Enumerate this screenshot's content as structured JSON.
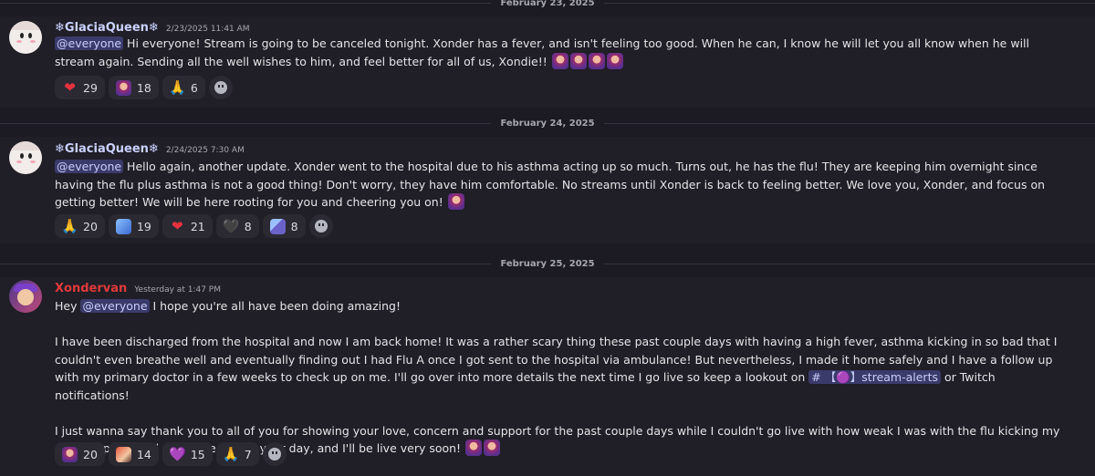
{
  "dividers": {
    "d0": "February 23, 2025",
    "d1": "February 24, 2025",
    "d2": "February 25, 2025"
  },
  "messages": [
    {
      "author": "❄GlaciaQueen❄",
      "timestamp": "2/23/2025 11:41 AM",
      "mention": "@everyone",
      "text": " Hi everyone! Stream is going to be canceled tonight. Xonder has a fever, and isn't feeling too good. When he can, I know he will let you all know when he will stream again. Sending all the well wishes to him, and feel better for all of us, Xondie!! ",
      "reactions": [
        {
          "icon": "red-heart-icon",
          "count": "29"
        },
        {
          "icon": "xonder-emote-icon",
          "count": "18"
        },
        {
          "icon": "folded-hands-icon",
          "count": "6"
        }
      ]
    },
    {
      "author": "❄GlaciaQueen❄",
      "timestamp": "2/24/2025 7:30 AM",
      "mention": "@everyone",
      "text": " Hello again, another update. Xonder went to the hospital due to his asthma acting up so much. Turns out, he has the flu! They are keeping him overnight since having the flu plus asthma is not a good thing! Don't worry, they have him comfortable. No streams until Xonder is back to feeling better. We love you, Xonder, and focus on getting better! We will be here rooting for you and cheering you on! ",
      "reactions": [
        {
          "icon": "folded-hands-icon",
          "count": "20"
        },
        {
          "icon": "blue-character-emote-icon",
          "count": "19"
        },
        {
          "icon": "red-heart-icon",
          "count": "21"
        },
        {
          "icon": "black-heart-icon",
          "count": "8"
        },
        {
          "icon": "pixel-character-emote-icon",
          "count": "8"
        }
      ]
    },
    {
      "author": "Xondervan",
      "timestamp": "Yesterday at 1:47 PM",
      "line1_prefix": "Hey ",
      "mention": "@everyone",
      "line1_suffix": " I hope you're all have been doing amazing!",
      "para2": "I have been discharged from the hospital and now I am back home! It was a rather scary thing these past couple days with having a high fever, asthma kicking in so bad that I couldn't even breathe well and eventually finding out I had Flu A once I got sent to the hospital via ambulance! But nevertheless, I made it home safely and I have a follow up with my primary doctor in a few weeks to check up on me. I'll go over into more details the next time I go live so keep a lookout on ",
      "channel": "# 【🟣】stream-alerts",
      "para2_suffix": " or Twitch notifications!",
      "para3": "I just wanna say thank you to all of you for showing your love, concern and support for the past couple days while I couldn't go live with how weak I was with the flu kicking my ass! I hope you all enjoy the rest of your day, and I'll be live very soon! ",
      "reactions": [
        {
          "icon": "xonder-emote-icon",
          "count": "20"
        },
        {
          "icon": "fighter-emote-icon",
          "count": "14"
        },
        {
          "icon": "purple-heart-icon",
          "count": "15"
        },
        {
          "icon": "folded-hands-icon",
          "count": "7"
        }
      ]
    }
  ],
  "glyphs": {
    "heart": "❤",
    "pray": "🙏",
    "purple_heart": "💜",
    "black_heart": "🖤"
  }
}
